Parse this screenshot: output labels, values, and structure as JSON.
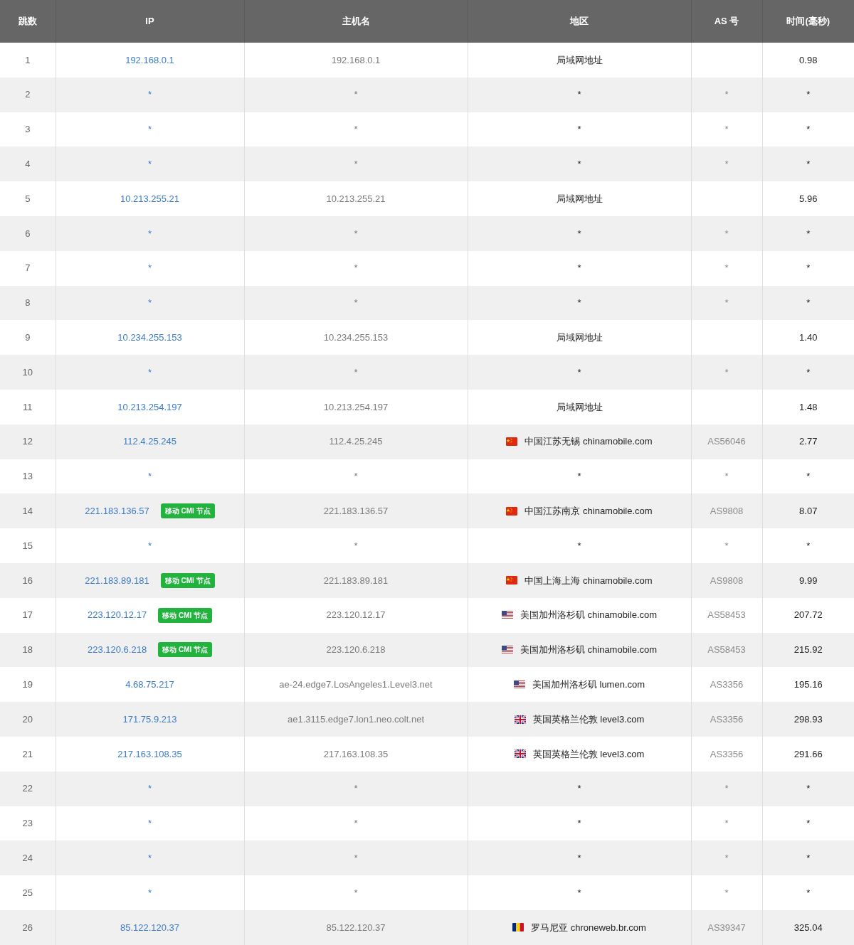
{
  "table": {
    "columns": [
      "跳数",
      "IP",
      "主机名",
      "地区",
      "AS 号",
      "时间(毫秒)"
    ],
    "rows": [
      {
        "hop": "1",
        "ip": "192.168.0.1",
        "host": "192.168.0.1",
        "region": "局域网地址",
        "time": "0.98"
      },
      {
        "hop": "2",
        "ip": "*",
        "host": "*",
        "region": "*",
        "as": "*",
        "time": "*"
      },
      {
        "hop": "3",
        "ip": "*",
        "host": "*",
        "region": "*",
        "as": "*",
        "time": "*"
      },
      {
        "hop": "4",
        "ip": "*",
        "host": "*",
        "region": "*",
        "as": "*",
        "time": "*"
      },
      {
        "hop": "5",
        "ip": "10.213.255.21",
        "host": "10.213.255.21",
        "region": "局域网地址",
        "time": "5.96"
      },
      {
        "hop": "6",
        "ip": "*",
        "host": "*",
        "region": "*",
        "as": "*",
        "time": "*"
      },
      {
        "hop": "7",
        "ip": "*",
        "host": "*",
        "region": "*",
        "as": "*",
        "time": "*"
      },
      {
        "hop": "8",
        "ip": "*",
        "host": "*",
        "region": "*",
        "as": "*",
        "time": "*"
      },
      {
        "hop": "9",
        "ip": "10.234.255.153",
        "host": "10.234.255.153",
        "region": "局域网地址",
        "time": "1.40"
      },
      {
        "hop": "10",
        "ip": "*",
        "host": "*",
        "region": "*",
        "as": "*",
        "time": "*"
      },
      {
        "hop": "11",
        "ip": "10.213.254.197",
        "host": "10.213.254.197",
        "region": "局域网地址",
        "time": "1.48"
      },
      {
        "hop": "12",
        "ip": "112.4.25.245",
        "host": "112.4.25.245",
        "kind": "china",
        "region": "中国江苏无锡 chinamobile.com",
        "as": "AS56046",
        "time": "2.77"
      },
      {
        "hop": "13",
        "ip": "*",
        "host": "*",
        "region": "*",
        "as": "*",
        "time": "*"
      },
      {
        "hop": "14",
        "ip": "221.183.136.57",
        "badge": "移动 CMI 节点",
        "host": "221.183.136.57",
        "kind": "china",
        "region": "中国江苏南京 chinamobile.com",
        "as": "AS9808",
        "time": "8.07"
      },
      {
        "hop": "15",
        "ip": "*",
        "host": "*",
        "region": "*",
        "as": "*",
        "time": "*"
      },
      {
        "hop": "16",
        "ip": "221.183.89.181",
        "badge": "移动 CMI 节点",
        "host": "221.183.89.181",
        "kind": "china",
        "region": "中国上海上海 chinamobile.com",
        "as": "AS9808",
        "time": "9.99"
      },
      {
        "hop": "17",
        "ip": "223.120.12.17",
        "badge": "移动 CMI 节点",
        "host": "223.120.12.17",
        "kind": "usa",
        "region": "美国加州洛杉矶 chinamobile.com",
        "as": "AS58453",
        "time": "207.72"
      },
      {
        "hop": "18",
        "ip": "223.120.6.218",
        "badge": "移动 CMI 节点",
        "host": "223.120.6.218",
        "kind": "usa",
        "region": "美国加州洛杉矶 chinamobile.com",
        "as": "AS58453",
        "time": "215.92"
      },
      {
        "hop": "19",
        "ip": "4.68.75.217",
        "host": "ae-24.edge7.LosAngeles1.Level3.net",
        "kind": "usa",
        "region": "美国加州洛杉矶 lumen.com",
        "as": "AS3356",
        "time": "195.16"
      },
      {
        "hop": "20",
        "ip": "171.75.9.213",
        "host": "ae1.3115.edge7.lon1.neo.colt.net",
        "kind": "britain",
        "region": "英国英格兰伦敦 level3.com",
        "as": "AS3356",
        "time": "298.93"
      },
      {
        "hop": "21",
        "ip": "217.163.108.35",
        "host": "217.163.108.35",
        "kind": "britain",
        "region": "英国英格兰伦敦 level3.com",
        "as": "AS3356",
        "time": "291.66"
      },
      {
        "hop": "22",
        "ip": "*",
        "host": "*",
        "region": "*",
        "as": "*",
        "time": "*"
      },
      {
        "hop": "23",
        "ip": "*",
        "host": "*",
        "region": "*",
        "as": "*",
        "time": "*"
      },
      {
        "hop": "24",
        "ip": "*",
        "host": "*",
        "region": "*",
        "as": "*",
        "time": "*"
      },
      {
        "hop": "25",
        "ip": "*",
        "host": "*",
        "region": "*",
        "as": "*",
        "time": "*"
      },
      {
        "hop": "26",
        "ip": "85.122.120.37",
        "host": "85.122.120.37",
        "kind": "romania",
        "region": "罗马尼亚 chroneweb.br.com",
        "as": "AS39347",
        "time": "325.04"
      }
    ]
  }
}
